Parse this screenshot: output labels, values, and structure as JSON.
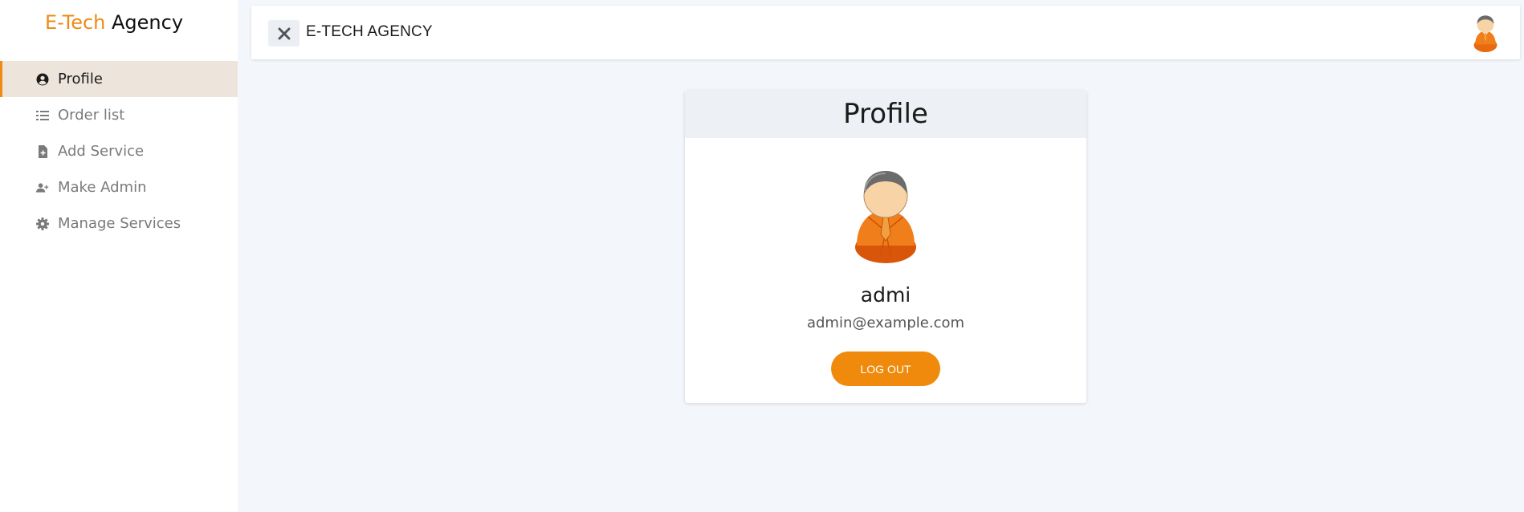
{
  "brand": {
    "part1": "E-Tech",
    "part2": "Agency"
  },
  "sidebar": {
    "items": [
      {
        "label": "Profile",
        "icon": "user-circle-icon",
        "active": true
      },
      {
        "label": "Order list",
        "icon": "list-icon",
        "active": false
      },
      {
        "label": "Add Service",
        "icon": "file-plus-icon",
        "active": false
      },
      {
        "label": "Make Admin",
        "icon": "user-plus-icon",
        "active": false
      },
      {
        "label": "Manage Services",
        "icon": "gear-icon",
        "active": false
      }
    ]
  },
  "topbar": {
    "title": "E-TECH AGENCY",
    "close_icon": "close-icon",
    "avatar_icon": "user-avatar-icon"
  },
  "profile": {
    "header": "Profile",
    "name": "admi",
    "email": "admin@example.com",
    "logout_label": "LOG OUT"
  },
  "colors": {
    "accent": "#ef8a14",
    "active_bg": "#ede5dc",
    "page_bg": "#f3f6fa"
  }
}
